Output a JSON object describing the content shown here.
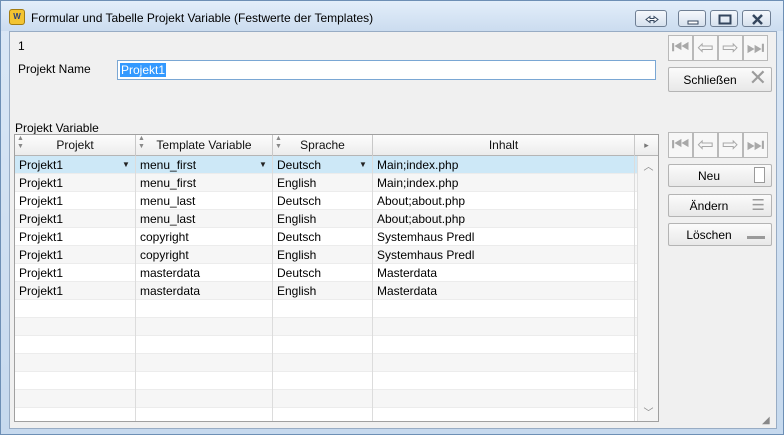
{
  "window": {
    "title": "Formular und Tabelle Projekt Variable (Festwerte der Templates)",
    "app_icon_text": "W"
  },
  "form": {
    "record_number": "1",
    "projekt_name_label": "Projekt Name",
    "projekt_name_value": "Projekt1",
    "section_label": "Projekt Variable"
  },
  "buttons": {
    "close": "Schließen",
    "new": "Neu",
    "edit": "Ändern",
    "delete": "Löschen"
  },
  "icons": {
    "first": "first-record-icon",
    "prev": "previous-record-icon",
    "next": "next-record-icon",
    "last": "last-record-icon"
  },
  "table": {
    "columns": [
      "Projekt",
      "Template Variable",
      "Sprache",
      "Inhalt"
    ],
    "rows": [
      [
        "Projekt1",
        "menu_first",
        "Deutsch",
        "Main;index.php"
      ],
      [
        "Projekt1",
        "menu_first",
        "English",
        "Main;index.php"
      ],
      [
        "Projekt1",
        "menu_last",
        "Deutsch",
        "About;about.php"
      ],
      [
        "Projekt1",
        "menu_last",
        "English",
        "About;about.php"
      ],
      [
        "Projekt1",
        "copyright",
        "Deutsch",
        "Systemhaus Predl"
      ],
      [
        "Projekt1",
        "copyright",
        "English",
        "Systemhaus Predl"
      ],
      [
        "Projekt1",
        "masterdata",
        "Deutsch",
        "Masterdata"
      ],
      [
        "Projekt1",
        "masterdata",
        "English",
        "Masterdata"
      ]
    ],
    "empty_rows": 7,
    "selected_row": 0
  }
}
